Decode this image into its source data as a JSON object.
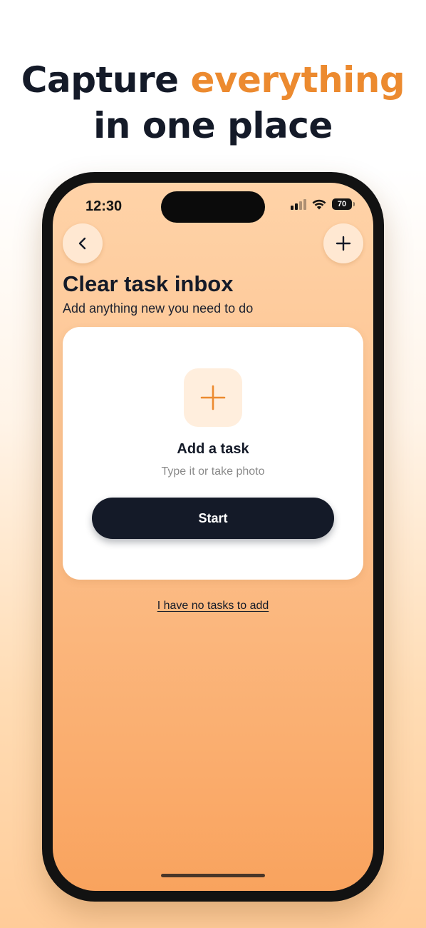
{
  "headline": {
    "part1": "Capture ",
    "accent": "everything",
    "line2": "in one place"
  },
  "status_bar": {
    "time": "12:30",
    "battery": "70"
  },
  "nav": {
    "back_icon": "chevron-left-icon",
    "add_icon": "plus-icon"
  },
  "page": {
    "title": "Clear task inbox",
    "subtitle": "Add anything new you need to do"
  },
  "card": {
    "icon": "plus-icon",
    "title": "Add a task",
    "subtitle": "Type it or take photo",
    "start_label": "Start"
  },
  "skip_link": "I have no tasks to add",
  "colors": {
    "accent": "#ec8a2f",
    "dark": "#141a28"
  }
}
